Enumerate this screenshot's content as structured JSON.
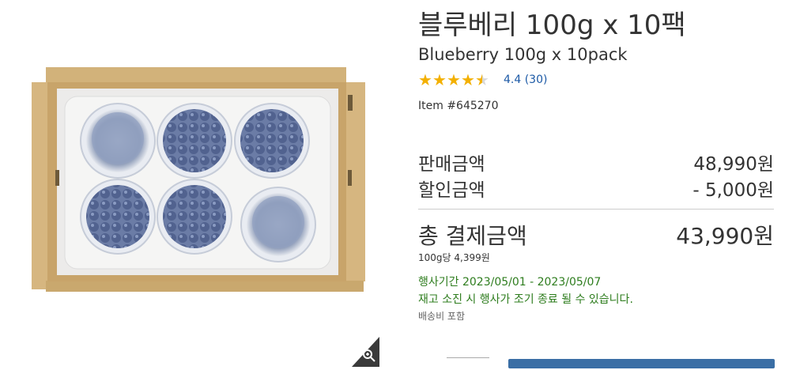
{
  "product": {
    "title_ko": "블루베리 100g x 10팩",
    "title_en": "Blueberry 100g x 10pack",
    "rating_value": 4.4,
    "rating_text": "4.4 (30)",
    "item_number": "Item #645270"
  },
  "pricing": {
    "sale_label": "판매금액",
    "sale_value": "48,990원",
    "discount_label": "할인금액",
    "discount_value": "- 5,000원",
    "total_label": "총 결제금액",
    "total_value": "43,990원",
    "unit_price": "100g당 4,399원"
  },
  "promo": {
    "period": "행사기간 2023/05/01 - 2023/05/07",
    "notice": "재고 소진 시 행사가 조기 종료 될 수 있습니다.",
    "shipping": "배송비 포함"
  },
  "icons": {
    "zoom": "magnifier-plus-icon",
    "star": "star-icon"
  },
  "colors": {
    "star": "#f3b000",
    "link": "#1d5aa6",
    "promo_green": "#2e7d1e",
    "cart_button": "#3a6ea5"
  }
}
